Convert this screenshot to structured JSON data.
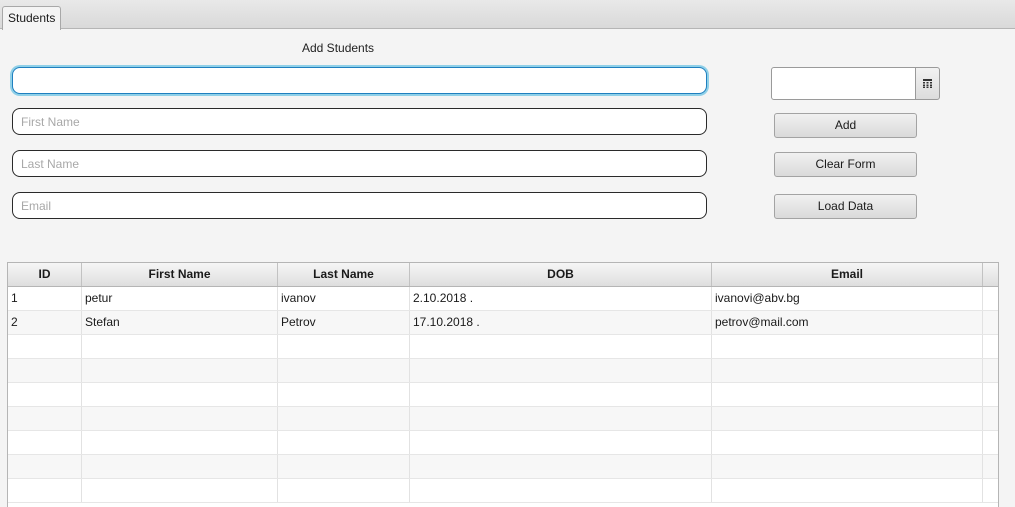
{
  "tab": {
    "label": "Students"
  },
  "form": {
    "heading": "Add Students",
    "id_value": "",
    "first_name_placeholder": "First Name",
    "last_name_placeholder": "Last Name",
    "email_placeholder": "Email",
    "date_value": ""
  },
  "buttons": {
    "add": "Add",
    "clear": "Clear Form",
    "load": "Load Data"
  },
  "icons": {
    "date_picker": "calendar-icon"
  },
  "table": {
    "columns": [
      "ID",
      "First Name",
      "Last Name",
      "DOB",
      "Email"
    ],
    "rows": [
      [
        "1",
        "petur",
        "ivanov",
        "2.10.2018 .",
        "ivanovi@abv.bg"
      ],
      [
        "2",
        "Stefan",
        "Petrov",
        "17.10.2018 .",
        "petrov@mail.com"
      ],
      [
        "",
        "",
        "",
        "",
        ""
      ],
      [
        "",
        "",
        "",
        "",
        ""
      ],
      [
        "",
        "",
        "",
        "",
        ""
      ],
      [
        "",
        "",
        "",
        "",
        ""
      ],
      [
        "",
        "",
        "",
        "",
        ""
      ],
      [
        "",
        "",
        "",
        "",
        ""
      ],
      [
        "",
        "",
        "",
        "",
        ""
      ]
    ]
  },
  "colors": {
    "focus": "#1f7fbf",
    "focus_glow": "#8fd0e8"
  }
}
